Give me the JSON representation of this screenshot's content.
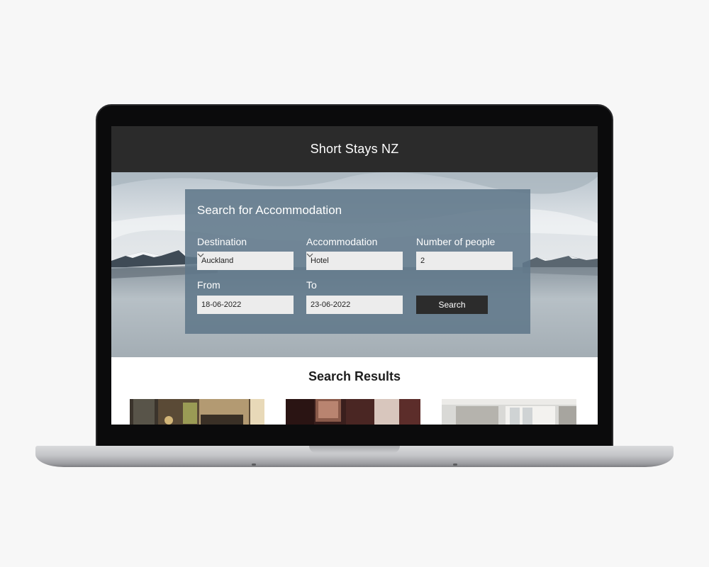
{
  "site": {
    "title": "Short Stays NZ"
  },
  "search": {
    "title": "Search for Accommodation",
    "destination": {
      "label": "Destination",
      "value": "Auckland"
    },
    "accommodation": {
      "label": "Accommodation",
      "value": "Hotel"
    },
    "people": {
      "label": "Number of people",
      "value": "2"
    },
    "from": {
      "label": "From",
      "value": "18-06-2022"
    },
    "to": {
      "label": "To",
      "value": "23-06-2022"
    },
    "button_label": "Search"
  },
  "results": {
    "title": "Search Results"
  },
  "colors": {
    "topbar": "#2b2b2b",
    "panel": "#60788a",
    "button": "#2c2c2c",
    "field": "#ececec"
  }
}
